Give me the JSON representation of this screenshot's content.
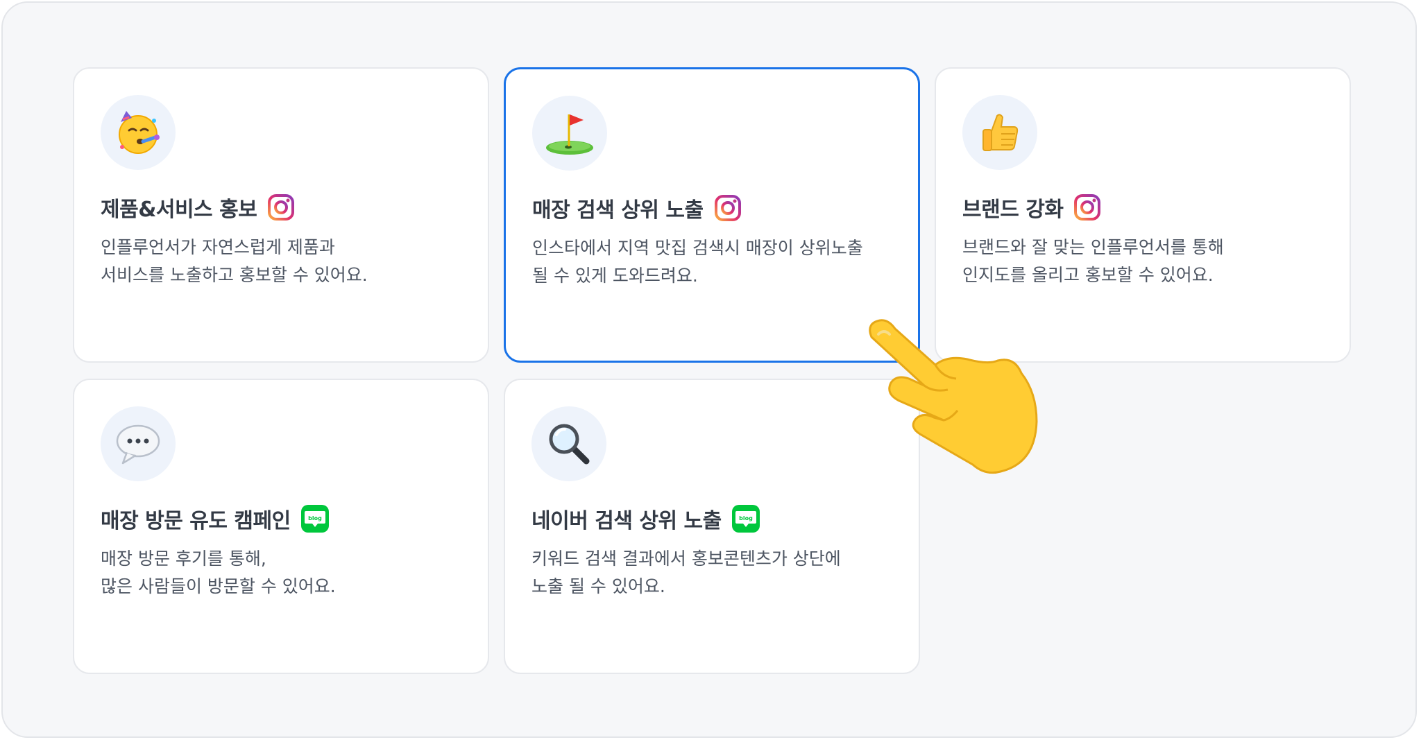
{
  "cards": [
    {
      "title": "제품&서비스 홍보",
      "desc_line1": "인플루언서가 자연스럽게 제품과",
      "desc_line2": "서비스를 노출하고 홍보할 수 있어요.",
      "icon": "partying-face-icon",
      "channel": "instagram"
    },
    {
      "title": "매장 검색 상위 노출",
      "desc_line1": "인스타에서 지역 맛집 검색시 매장이 상위노출",
      "desc_line2": "될 수 있게 도와드려요.",
      "icon": "golf-flag-icon",
      "channel": "instagram",
      "selected": true
    },
    {
      "title": "브랜드 강화",
      "desc_line1": "브랜드와 잘 맞는 인플루언서를 통해",
      "desc_line2": "인지도를 올리고 홍보할 수 있어요.",
      "icon": "thumbs-up-icon",
      "channel": "instagram"
    },
    {
      "title": "매장 방문 유도 캠페인",
      "desc_line1": "매장 방문 후기를 통해,",
      "desc_line2": "많은 사람들이 방문할 수 있어요.",
      "icon": "speech-bubble-icon",
      "channel": "blog"
    },
    {
      "title": "네이버 검색 상위 노출",
      "desc_line1": "키워드 검색 결과에서 홍보콘텐츠가 상단에",
      "desc_line2": "노출 될 수 있어요.",
      "icon": "magnifier-icon",
      "channel": "blog"
    }
  ],
  "blog_badge_text": "blog",
  "colors": {
    "selected_border": "#1a73e8",
    "blog_green": "#00c73c",
    "page_bg": "#f6f7f9"
  },
  "pointer": "pointing-hand-icon"
}
